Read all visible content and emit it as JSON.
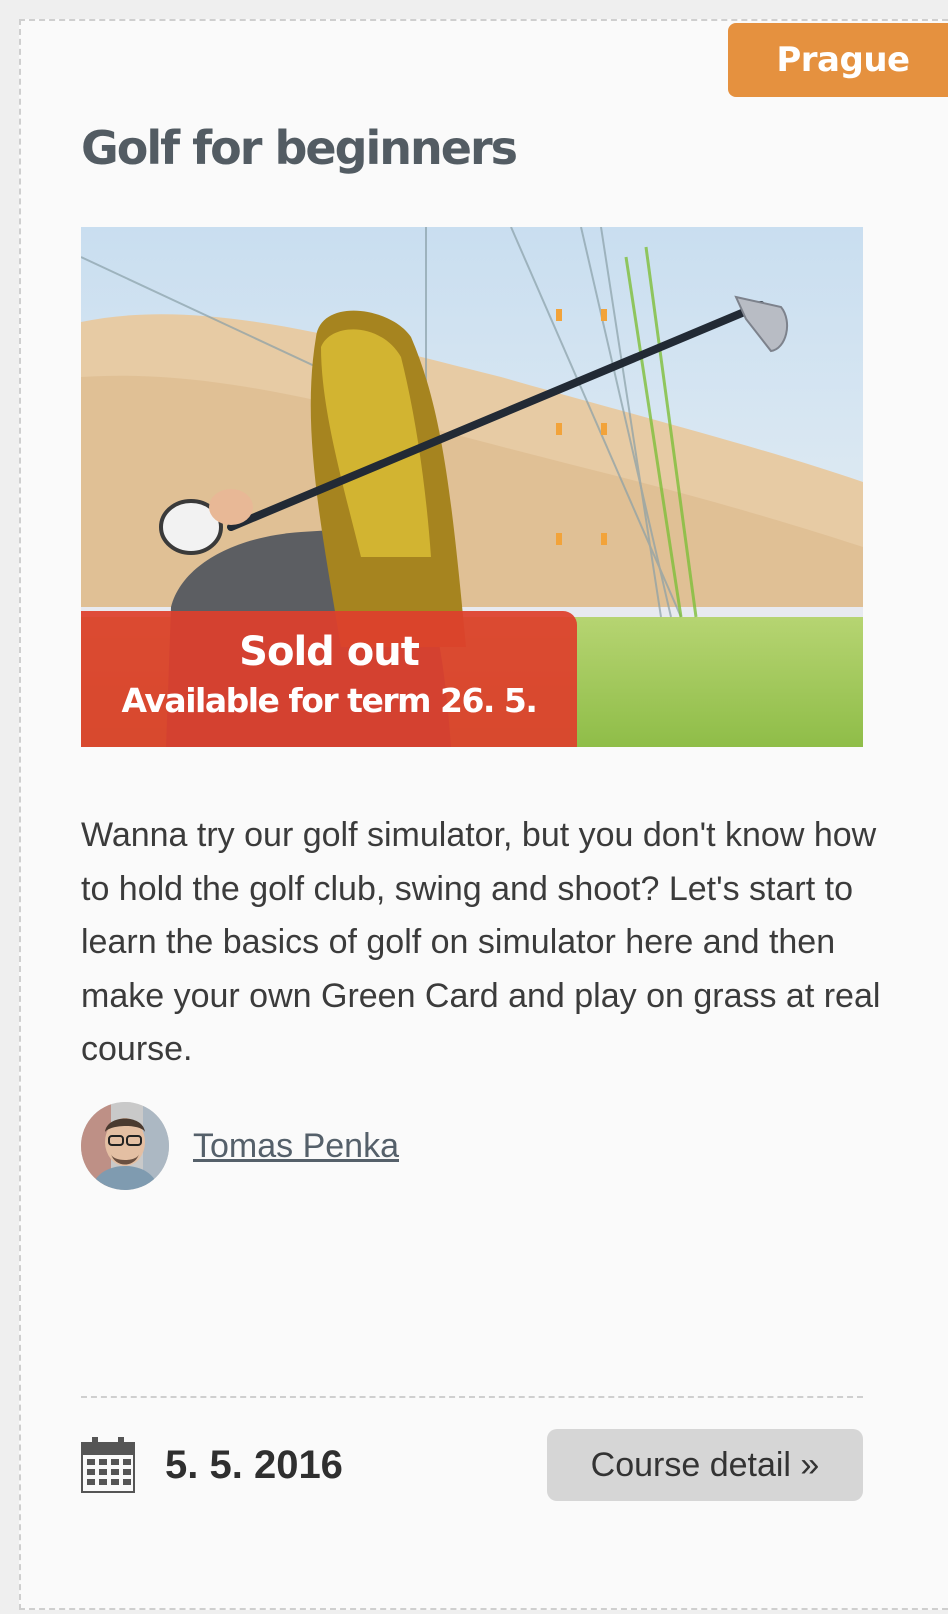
{
  "card": {
    "city": "Prague",
    "title": "Golf for beginners",
    "availability": {
      "status": "Sold out",
      "note": "Available for term 26. 5."
    },
    "description": "Wanna try our golf simulator, but you don't know how to hold the golf club, swing and shoot? Let's start to learn the basics of golf on simulator here and then make your own Green Card and play on grass at real course.",
    "instructor": {
      "name": "Tomas Penka"
    },
    "date": "5. 5. 2016",
    "detail_button": "Course detail »",
    "icons": {
      "date": "calendar-icon",
      "instructor": "avatar"
    },
    "colors": {
      "city_badge": "#e5913f",
      "sold_out_banner": "#de402c",
      "title": "#535c63",
      "button": "#d6d6d6"
    }
  }
}
